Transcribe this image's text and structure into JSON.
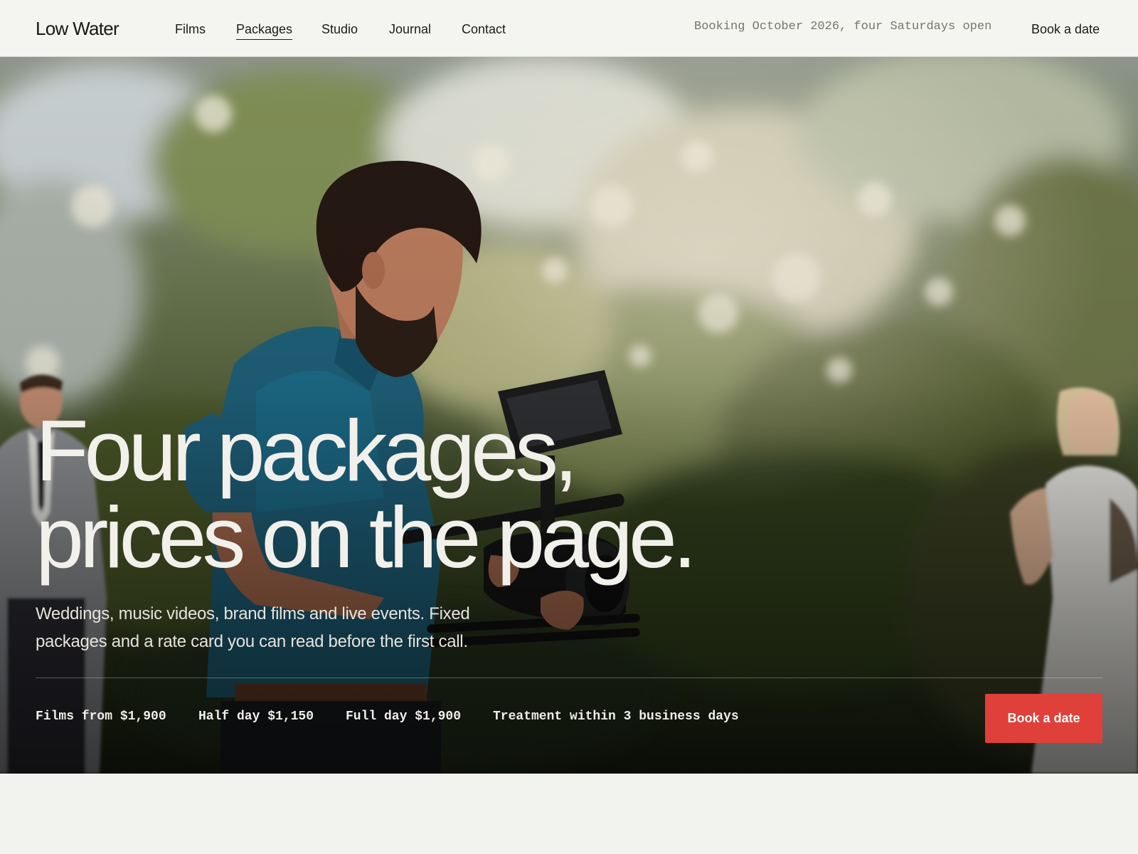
{
  "brand": {
    "name": "Low Water"
  },
  "nav": {
    "items": [
      {
        "label": "Films",
        "active": false
      },
      {
        "label": "Packages",
        "active": true
      },
      {
        "label": "Studio",
        "active": false
      },
      {
        "label": "Journal",
        "active": false
      },
      {
        "label": "Contact",
        "active": false
      }
    ]
  },
  "header": {
    "booking_note": "Booking October 2026, four Saturdays open",
    "cta_label": "Book a date"
  },
  "hero": {
    "image": "videographer-with-camera-rig-at-outdoor-wedding",
    "headline_line1": "Four packages,",
    "headline_line2": "prices on the page.",
    "subhead": "Weddings, music videos, brand films and live events. Fixed packages and a rate card you can read before the first call.",
    "facts": [
      "Films from $1,900",
      "Half day $1,150",
      "Full day $1,900",
      "Treatment within 3 business days"
    ],
    "cta_label": "Book a date"
  },
  "colors": {
    "accent": "#e0403a",
    "background": "#f2f2ee",
    "headline_text": "#f2f0ea"
  }
}
